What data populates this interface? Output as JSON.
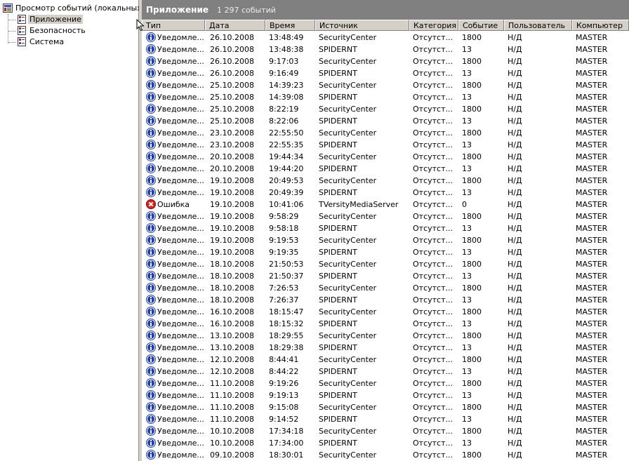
{
  "tree": {
    "root": "Просмотр событий (локальных)",
    "items": [
      {
        "label": "Приложение",
        "selected": true
      },
      {
        "label": "Безопасность",
        "selected": false
      },
      {
        "label": "Система",
        "selected": false
      }
    ]
  },
  "header": {
    "title": "Приложение",
    "count": "1 297 событий"
  },
  "columns": [
    "Тип",
    "Дата",
    "Время",
    "Источник",
    "Категория",
    "Событие",
    "Пользователь",
    "Компьютер"
  ],
  "rows": [
    {
      "type": "info",
      "type_label": "Уведомле...",
      "date": "26.10.2008",
      "time": "13:48:49",
      "source": "SecurityCenter",
      "category": "Отсутст...",
      "event": "1800",
      "user": "Н/Д",
      "computer": "MASTER"
    },
    {
      "type": "info",
      "type_label": "Уведомле...",
      "date": "26.10.2008",
      "time": "13:48:38",
      "source": "SPIDERNT",
      "category": "Отсутст...",
      "event": "13",
      "user": "Н/Д",
      "computer": "MASTER"
    },
    {
      "type": "info",
      "type_label": "Уведомле...",
      "date": "26.10.2008",
      "time": "9:17:03",
      "source": "SecurityCenter",
      "category": "Отсутст...",
      "event": "1800",
      "user": "Н/Д",
      "computer": "MASTER"
    },
    {
      "type": "info",
      "type_label": "Уведомле...",
      "date": "26.10.2008",
      "time": "9:16:49",
      "source": "SPIDERNT",
      "category": "Отсутст...",
      "event": "13",
      "user": "Н/Д",
      "computer": "MASTER"
    },
    {
      "type": "info",
      "type_label": "Уведомле...",
      "date": "25.10.2008",
      "time": "14:39:23",
      "source": "SecurityCenter",
      "category": "Отсутст...",
      "event": "1800",
      "user": "Н/Д",
      "computer": "MASTER"
    },
    {
      "type": "info",
      "type_label": "Уведомле...",
      "date": "25.10.2008",
      "time": "14:39:08",
      "source": "SPIDERNT",
      "category": "Отсутст...",
      "event": "13",
      "user": "Н/Д",
      "computer": "MASTER"
    },
    {
      "type": "info",
      "type_label": "Уведомле...",
      "date": "25.10.2008",
      "time": "8:22:19",
      "source": "SecurityCenter",
      "category": "Отсутст...",
      "event": "1800",
      "user": "Н/Д",
      "computer": "MASTER"
    },
    {
      "type": "info",
      "type_label": "Уведомле...",
      "date": "25.10.2008",
      "time": "8:22:06",
      "source": "SPIDERNT",
      "category": "Отсутст...",
      "event": "13",
      "user": "Н/Д",
      "computer": "MASTER"
    },
    {
      "type": "info",
      "type_label": "Уведомле...",
      "date": "23.10.2008",
      "time": "22:55:50",
      "source": "SecurityCenter",
      "category": "Отсутст...",
      "event": "1800",
      "user": "Н/Д",
      "computer": "MASTER"
    },
    {
      "type": "info",
      "type_label": "Уведомле...",
      "date": "23.10.2008",
      "time": "22:55:35",
      "source": "SPIDERNT",
      "category": "Отсутст...",
      "event": "13",
      "user": "Н/Д",
      "computer": "MASTER"
    },
    {
      "type": "info",
      "type_label": "Уведомле...",
      "date": "20.10.2008",
      "time": "19:44:34",
      "source": "SecurityCenter",
      "category": "Отсутст...",
      "event": "1800",
      "user": "Н/Д",
      "computer": "MASTER"
    },
    {
      "type": "info",
      "type_label": "Уведомле...",
      "date": "20.10.2008",
      "time": "19:44:20",
      "source": "SPIDERNT",
      "category": "Отсутст...",
      "event": "13",
      "user": "Н/Д",
      "computer": "MASTER"
    },
    {
      "type": "info",
      "type_label": "Уведомле...",
      "date": "19.10.2008",
      "time": "20:49:53",
      "source": "SecurityCenter",
      "category": "Отсутст...",
      "event": "1800",
      "user": "Н/Д",
      "computer": "MASTER"
    },
    {
      "type": "info",
      "type_label": "Уведомле...",
      "date": "19.10.2008",
      "time": "20:49:39",
      "source": "SPIDERNT",
      "category": "Отсутст...",
      "event": "13",
      "user": "Н/Д",
      "computer": "MASTER"
    },
    {
      "type": "error",
      "type_label": "Ошибка",
      "date": "19.10.2008",
      "time": "10:41:06",
      "source": "TVersityMediaServer",
      "category": "Отсутст...",
      "event": "0",
      "user": "Н/Д",
      "computer": "MASTER"
    },
    {
      "type": "info",
      "type_label": "Уведомле...",
      "date": "19.10.2008",
      "time": "9:58:29",
      "source": "SecurityCenter",
      "category": "Отсутст...",
      "event": "1800",
      "user": "Н/Д",
      "computer": "MASTER"
    },
    {
      "type": "info",
      "type_label": "Уведомле...",
      "date": "19.10.2008",
      "time": "9:58:18",
      "source": "SPIDERNT",
      "category": "Отсутст...",
      "event": "13",
      "user": "Н/Д",
      "computer": "MASTER"
    },
    {
      "type": "info",
      "type_label": "Уведомле...",
      "date": "19.10.2008",
      "time": "9:19:53",
      "source": "SecurityCenter",
      "category": "Отсутст...",
      "event": "1800",
      "user": "Н/Д",
      "computer": "MASTER"
    },
    {
      "type": "info",
      "type_label": "Уведомле...",
      "date": "19.10.2008",
      "time": "9:19:35",
      "source": "SPIDERNT",
      "category": "Отсутст...",
      "event": "13",
      "user": "Н/Д",
      "computer": "MASTER"
    },
    {
      "type": "info",
      "type_label": "Уведомле...",
      "date": "18.10.2008",
      "time": "21:50:53",
      "source": "SecurityCenter",
      "category": "Отсутст...",
      "event": "1800",
      "user": "Н/Д",
      "computer": "MASTER"
    },
    {
      "type": "info",
      "type_label": "Уведомле...",
      "date": "18.10.2008",
      "time": "21:50:37",
      "source": "SPIDERNT",
      "category": "Отсутст...",
      "event": "13",
      "user": "Н/Д",
      "computer": "MASTER"
    },
    {
      "type": "info",
      "type_label": "Уведомле...",
      "date": "18.10.2008",
      "time": "7:26:53",
      "source": "SecurityCenter",
      "category": "Отсутст...",
      "event": "1800",
      "user": "Н/Д",
      "computer": "MASTER"
    },
    {
      "type": "info",
      "type_label": "Уведомле...",
      "date": "18.10.2008",
      "time": "7:26:37",
      "source": "SPIDERNT",
      "category": "Отсутст...",
      "event": "13",
      "user": "Н/Д",
      "computer": "MASTER"
    },
    {
      "type": "info",
      "type_label": "Уведомле...",
      "date": "16.10.2008",
      "time": "18:15:47",
      "source": "SecurityCenter",
      "category": "Отсутст...",
      "event": "1800",
      "user": "Н/Д",
      "computer": "MASTER"
    },
    {
      "type": "info",
      "type_label": "Уведомле...",
      "date": "16.10.2008",
      "time": "18:15:32",
      "source": "SPIDERNT",
      "category": "Отсутст...",
      "event": "13",
      "user": "Н/Д",
      "computer": "MASTER"
    },
    {
      "type": "info",
      "type_label": "Уведомле...",
      "date": "13.10.2008",
      "time": "18:29:55",
      "source": "SecurityCenter",
      "category": "Отсутст...",
      "event": "1800",
      "user": "Н/Д",
      "computer": "MASTER"
    },
    {
      "type": "info",
      "type_label": "Уведомле...",
      "date": "13.10.2008",
      "time": "18:29:38",
      "source": "SPIDERNT",
      "category": "Отсутст...",
      "event": "13",
      "user": "Н/Д",
      "computer": "MASTER"
    },
    {
      "type": "info",
      "type_label": "Уведомле...",
      "date": "12.10.2008",
      "time": "8:44:41",
      "source": "SecurityCenter",
      "category": "Отсутст...",
      "event": "1800",
      "user": "Н/Д",
      "computer": "MASTER"
    },
    {
      "type": "info",
      "type_label": "Уведомле...",
      "date": "12.10.2008",
      "time": "8:44:22",
      "source": "SPIDERNT",
      "category": "Отсутст...",
      "event": "13",
      "user": "Н/Д",
      "computer": "MASTER"
    },
    {
      "type": "info",
      "type_label": "Уведомле...",
      "date": "11.10.2008",
      "time": "9:19:26",
      "source": "SecurityCenter",
      "category": "Отсутст...",
      "event": "1800",
      "user": "Н/Д",
      "computer": "MASTER"
    },
    {
      "type": "info",
      "type_label": "Уведомле...",
      "date": "11.10.2008",
      "time": "9:19:13",
      "source": "SPIDERNT",
      "category": "Отсутст...",
      "event": "13",
      "user": "Н/Д",
      "computer": "MASTER"
    },
    {
      "type": "info",
      "type_label": "Уведомле...",
      "date": "11.10.2008",
      "time": "9:15:08",
      "source": "SecurityCenter",
      "category": "Отсутст...",
      "event": "1800",
      "user": "Н/Д",
      "computer": "MASTER"
    },
    {
      "type": "info",
      "type_label": "Уведомле...",
      "date": "11.10.2008",
      "time": "9:14:52",
      "source": "SPIDERNT",
      "category": "Отсутст...",
      "event": "13",
      "user": "Н/Д",
      "computer": "MASTER"
    },
    {
      "type": "info",
      "type_label": "Уведомле...",
      "date": "10.10.2008",
      "time": "17:34:18",
      "source": "SecurityCenter",
      "category": "Отсутст...",
      "event": "1800",
      "user": "Н/Д",
      "computer": "MASTER"
    },
    {
      "type": "info",
      "type_label": "Уведомле...",
      "date": "10.10.2008",
      "time": "17:34:00",
      "source": "SPIDERNT",
      "category": "Отсутст...",
      "event": "13",
      "user": "Н/Д",
      "computer": "MASTER"
    },
    {
      "type": "info",
      "type_label": "Уведомле...",
      "date": "09.10.2008",
      "time": "18:30:01",
      "source": "SecurityCenter",
      "category": "Отсутст...",
      "event": "1800",
      "user": "Н/Д",
      "computer": "MASTER"
    }
  ],
  "colors": {
    "title_bg": "#808080",
    "info_blue": "#1f3fb5",
    "error_red": "#e0201c",
    "header_bg": "#d4d0c8"
  }
}
